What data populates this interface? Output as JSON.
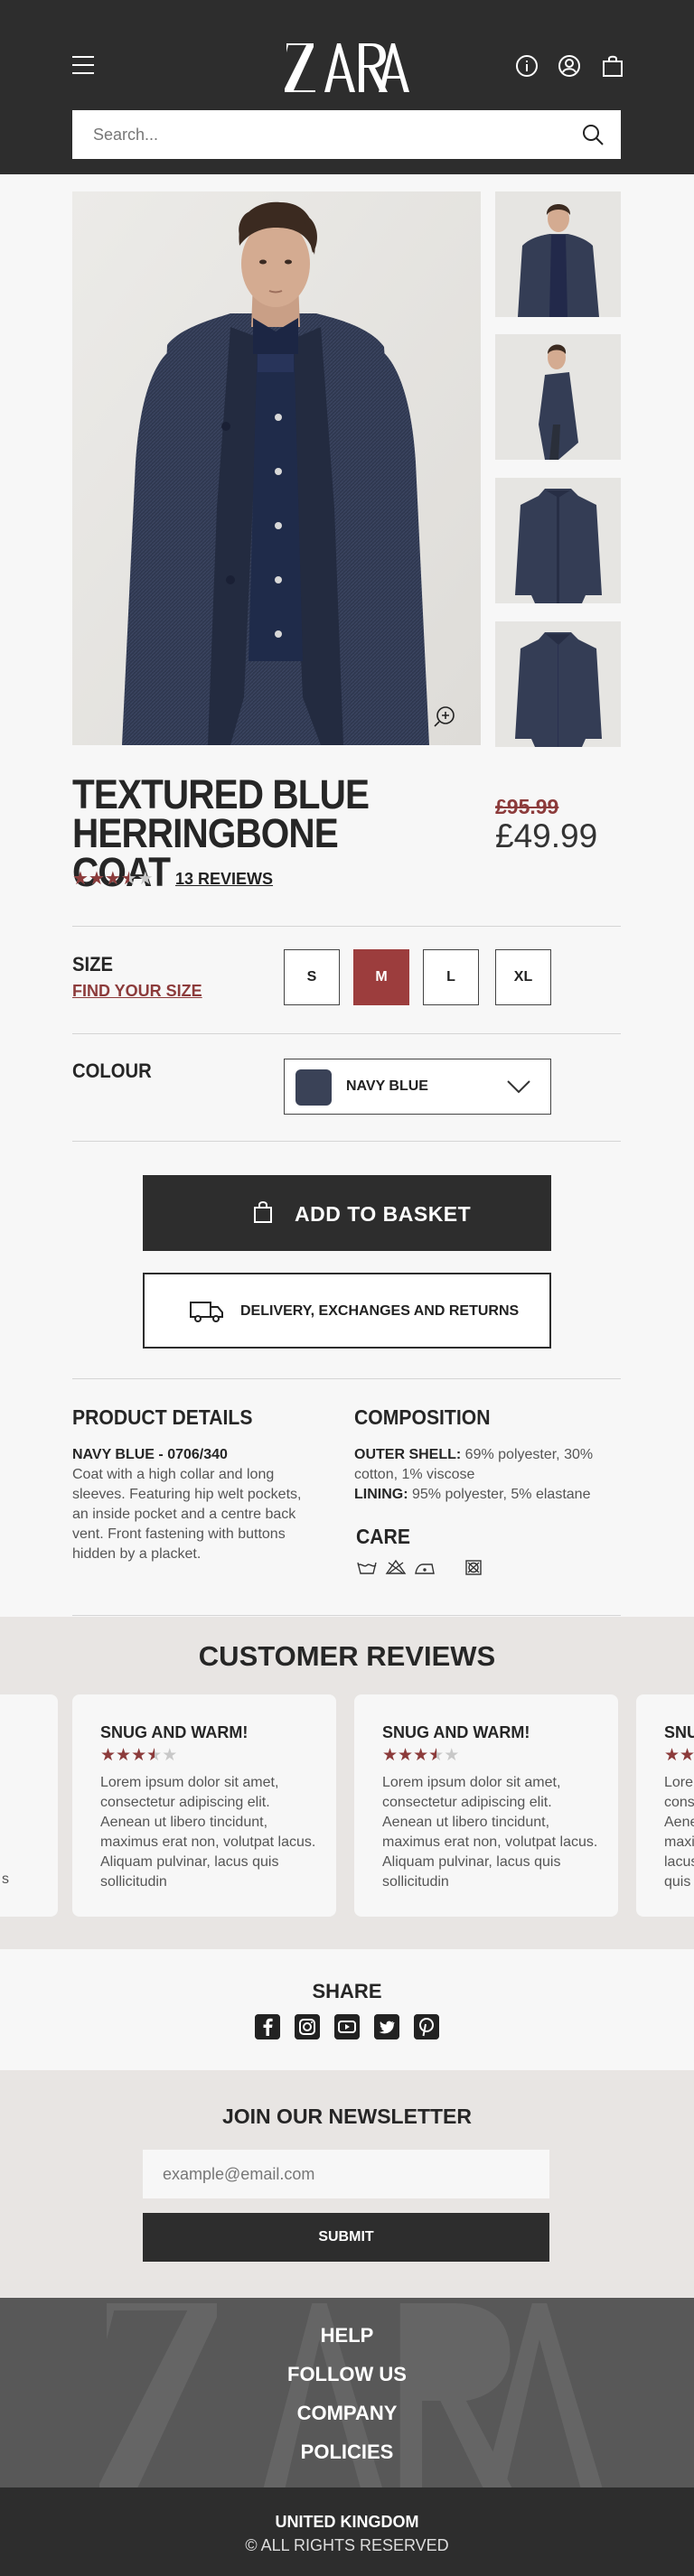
{
  "brand": {
    "logo_text": "ZARA"
  },
  "header": {
    "icons": [
      "menu-icon",
      "info-icon",
      "account-icon",
      "basket-icon"
    ],
    "search": {
      "placeholder": "Search..."
    }
  },
  "product": {
    "title": "TEXTURED BLUE HERRINGBONE COAT",
    "price_old": "£95.99",
    "price_new": "£49.99",
    "rating": 3.5,
    "rating_max": 5,
    "reviews_link": "13 REVIEWS",
    "size_label": "SIZE",
    "find_size": "FIND YOUR SIZE",
    "sizes": [
      "S",
      "M",
      "L",
      "XL"
    ],
    "selected_size": "M",
    "colour_label": "COLOUR",
    "colour_value": "NAVY BLUE",
    "add_to_basket": "ADD TO BASKET",
    "delivery": "DELIVERY, EXCHANGES AND RETURNS"
  },
  "details": {
    "heading": "PRODUCT DETAILS",
    "ref": "NAVY BLUE - 0706/340",
    "description": "Coat with a high collar and long sleeves. Featuring hip welt pockets, an inside pocket and a centre back vent. Front fastening with buttons hidden by a placket."
  },
  "composition": {
    "heading": "COMPOSITION",
    "outer_label": "OUTER SHELL:",
    "outer_value": "69% polyester, 30% cotton, 1% viscose",
    "lining_label": "LINING:",
    "lining_value": "95% polyester, 5% elastane",
    "care_heading": "CARE",
    "care_icons": [
      "wash-30-icon",
      "do-not-bleach-icon",
      "iron-low-icon",
      "tumble-dry-icon"
    ]
  },
  "reviews": {
    "heading": "CUSTOMER REVIEWS",
    "items": [
      {
        "title": "SNUG AND WARM!",
        "rating": 3.5,
        "body": "Lorem ipsum dolor sit amet, consectetur adipiscing elit. Aenean ut libero tincidunt, maximus erat non, volutpat lacus. Aliquam pulvinar, lacus quis sollicitudin"
      },
      {
        "title": "SNUG AND WARM!",
        "rating": 3.5,
        "body": "Lorem ipsum dolor sit amet, consectetur adipiscing elit. Aenean ut libero tincidunt, maximus erat non, volutpat lacus. Aliquam pulvinar, lacus quis sollicitudin"
      },
      {
        "title": "SNUG AND WARM!",
        "rating": 3.5,
        "body": "Lorem ipsum dolor sit amet, consectetur adipiscing elit. Aenean ut libero tincidunt, maximus erat non, volutpat lacus. Aliquam pulvinar, lacus quis sollicitudin"
      }
    ],
    "partial_left_tail": "s",
    "partial_right": {
      "title": "SNU",
      "body": "Lore cons Aene maxi lacus quis"
    }
  },
  "share": {
    "heading": "SHARE",
    "icons": [
      "facebook-icon",
      "instagram-icon",
      "youtube-icon",
      "twitter-icon",
      "pinterest-icon"
    ]
  },
  "newsletter": {
    "heading": "JOIN OUR NEWSLETTER",
    "placeholder": "example@email.com",
    "submit": "SUBMIT"
  },
  "footer": {
    "links": [
      "HELP",
      "FOLLOW US",
      "COMPANY",
      "POLICIES"
    ],
    "country": "UNITED KINGDOM",
    "copyright": "© ALL RIGHTS RESERVED"
  },
  "colors": {
    "accent": "#9c3d3d",
    "dark": "#2d2d2d",
    "star_filled": "#8c3b3b",
    "star_empty": "#c8c8c8",
    "navy": "#3a4257"
  }
}
